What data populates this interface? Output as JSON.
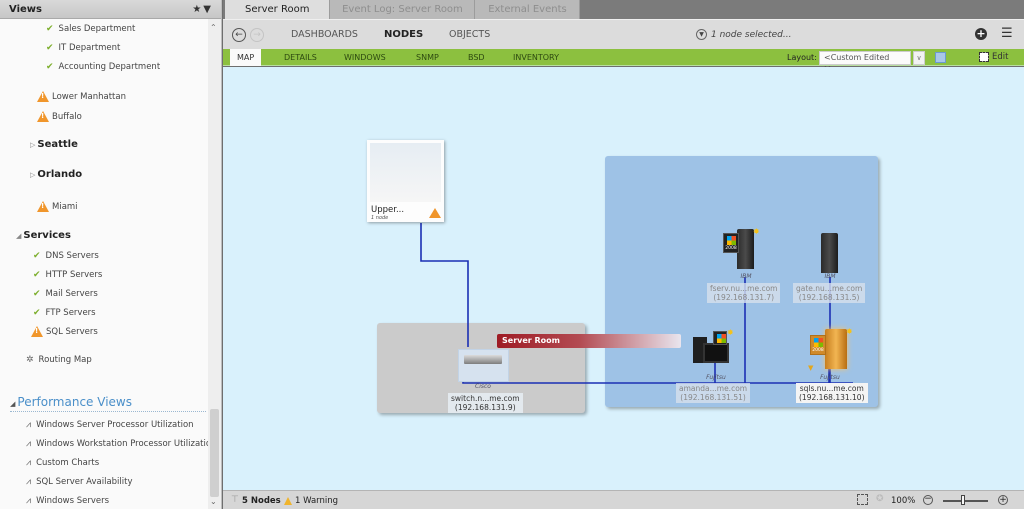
{
  "sidebar": {
    "title": "Views",
    "header_icons": [
      "star-icon",
      "filter-icon"
    ],
    "items": [
      {
        "label": "Sales Department",
        "status": "ok"
      },
      {
        "label": "IT Department",
        "status": "ok"
      },
      {
        "label": "Accounting Department",
        "status": "ok"
      },
      {
        "label": "Lower Manhattan",
        "status": "warning"
      },
      {
        "label": "Buffalo",
        "status": "warning"
      },
      {
        "label": "Seattle",
        "type": "group-collapsed"
      },
      {
        "label": "Orlando",
        "type": "group-collapsed"
      },
      {
        "label": "Miami",
        "status": "warning"
      },
      {
        "label": "Services",
        "type": "group-expanded"
      },
      {
        "label": "DNS Servers",
        "status": "ok"
      },
      {
        "label": "HTTP Servers",
        "status": "ok"
      },
      {
        "label": "Mail Servers",
        "status": "ok"
      },
      {
        "label": "FTP Servers",
        "status": "ok"
      },
      {
        "label": "SQL Servers",
        "status": "warning"
      },
      {
        "label": "Routing Map",
        "type": "routing"
      }
    ],
    "performance_title": "Performance Views",
    "performance_items": [
      "Windows Server Processor Utilization",
      "Windows Workstation Processor Utilization",
      "Custom Charts",
      "SQL Server Availability",
      "Windows Servers"
    ]
  },
  "tabs": [
    "Server Room",
    "Event Log: Server Room",
    "External Events"
  ],
  "nav": {
    "links": [
      "DASHBOARDS",
      "NODES",
      "OBJECTS"
    ],
    "active": "NODES",
    "selection_note": "1 node selected..."
  },
  "subnav": {
    "tabs": [
      "MAP",
      "DETAILS",
      "WINDOWS",
      "SNMP",
      "BSD",
      "INVENTORY"
    ],
    "active": "MAP",
    "layout_label": "Layout:",
    "layout_value": "<Custom Edited Map>",
    "edit_label": "Edit"
  },
  "map": {
    "submap": {
      "name": "Upper...",
      "count": "1 node",
      "status": "warning"
    },
    "group_label": "Server Room",
    "nodes": [
      {
        "id": "switch",
        "vendor": "Cisco",
        "name": "switch.n...me.com",
        "ip": "(192.168.131.9)"
      },
      {
        "id": "fserv",
        "vendor": "IBM",
        "name": "fserv.nu...me.com",
        "ip": "(192.168.131.7)",
        "os": "2008"
      },
      {
        "id": "gate",
        "vendor": "IBM",
        "name": "gate.nu...me.com",
        "ip": "(192.168.131.5)"
      },
      {
        "id": "amanda",
        "vendor": "Fujitsu",
        "name": "amanda...me.com",
        "ip": "(192.168.131.51)",
        "os": "Win 7"
      },
      {
        "id": "sqls",
        "vendor": "Fujitsu",
        "name": "sqls.nu...me.com",
        "ip": "(192.168.131.10)",
        "os": "2008",
        "selected": true
      }
    ]
  },
  "status": {
    "nodes": "5 Nodes",
    "warnings": "1 Warning",
    "zoom": "100%",
    "zoom_fraction": 0.45
  }
}
